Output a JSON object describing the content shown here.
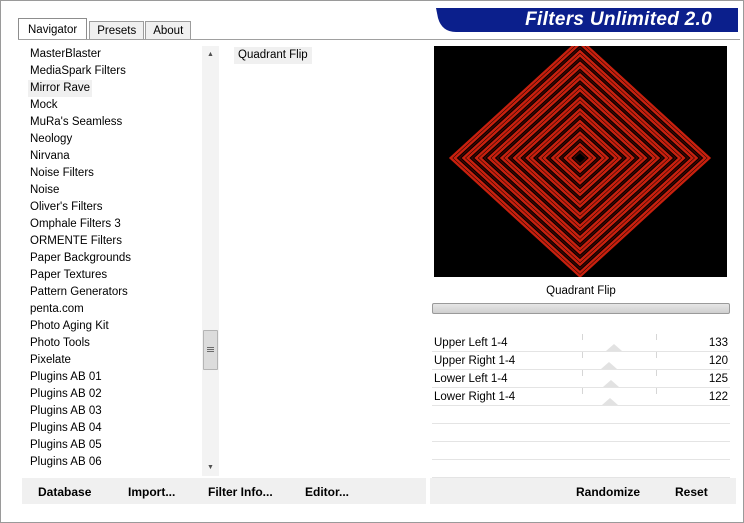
{
  "tabs": [
    "Navigator",
    "Presets",
    "About"
  ],
  "banner": {
    "title": "Filters Unlimited 2.0"
  },
  "categories": {
    "items": [
      "MasterBlaster",
      "MediaSpark Filters",
      "Mirror Rave",
      "Mock",
      "MuRa's Seamless",
      "Neology",
      "Nirvana",
      "Noise Filters",
      "Noise",
      "Oliver's Filters",
      "Omphale Filters 3",
      "ORMENTE Filters",
      "Paper Backgrounds",
      "Paper Textures",
      "Pattern Generators",
      "penta.com",
      "Photo Aging Kit",
      "Photo Tools",
      "Pixelate",
      "Plugins AB 01",
      "Plugins AB 02",
      "Plugins AB 03",
      "Plugins AB 04",
      "Plugins AB 05",
      "Plugins AB 06"
    ],
    "selected": "Mirror Rave"
  },
  "filters": {
    "items": [
      "Quadrant Flip"
    ],
    "selected": "Quadrant Flip"
  },
  "preview": {
    "caption": "Quadrant Flip"
  },
  "sliders": [
    {
      "label": "Upper Left 1-4",
      "value": "133",
      "max": 255
    },
    {
      "label": "Upper Right 1-4",
      "value": "120",
      "max": 255
    },
    {
      "label": "Lower Left 1-4",
      "value": "125",
      "max": 255
    },
    {
      "label": "Lower Right 1-4",
      "value": "122",
      "max": 255
    }
  ],
  "toolbar": {
    "database": "Database",
    "import": "Import...",
    "filter_info": "Filter Info...",
    "editor": "Editor...",
    "randomize": "Randomize",
    "reset": "Reset"
  },
  "colors": {
    "banner": "#0b1f8c",
    "preview_red": "#c8200e",
    "preview_bg": "#000000"
  }
}
